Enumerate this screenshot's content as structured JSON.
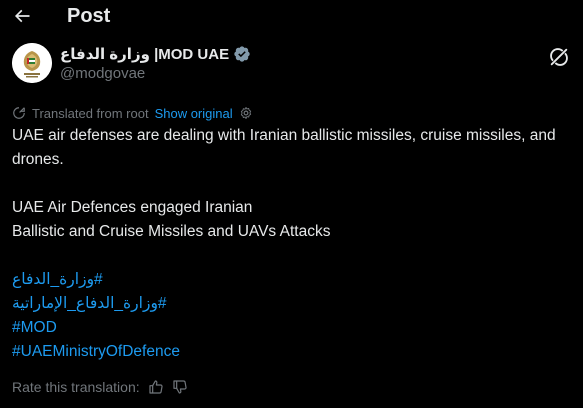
{
  "header": {
    "title": "Post"
  },
  "author": {
    "display_name": "وزارة الدفاع |MOD UAE",
    "handle": "@modgovae"
  },
  "translation": {
    "label": "Translated from root",
    "show_original": "Show original"
  },
  "post": {
    "line1": "UAE air defenses are dealing with Iranian ballistic missiles, cruise missiles, and drones.",
    "line2": "UAE Air Defences engaged Iranian",
    "line3": "Ballistic and Cruise Missiles and UAVs Attacks",
    "hashtags": [
      "#وزارة_الدفاع",
      "#وزارة_الدفاع_الإماراتية",
      "#MOD",
      "#UAEMinistryOfDefence"
    ]
  },
  "rating": {
    "label": "Rate this translation:"
  },
  "colors": {
    "background": "#000000",
    "text": "#e7e9ea",
    "muted": "#71767b",
    "accent": "#1d9bf0"
  }
}
